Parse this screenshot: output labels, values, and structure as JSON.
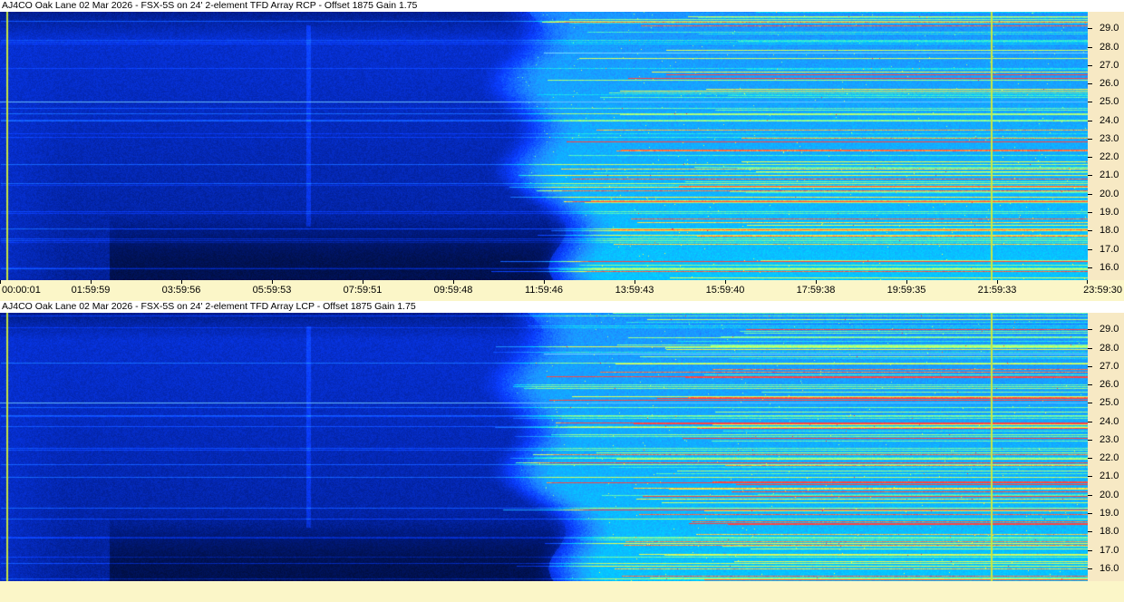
{
  "chart_data": [
    {
      "type": "heatmap",
      "title": "AJ4CO Oak Lane 02 Mar 2026 - FSX-5S on 24' 2-element TFD Array RCP  -  Offset 1875  Gain 1.75",
      "x_tick_labels": [
        "00:00:01",
        "01:59:59",
        "03:59:56",
        "05:59:53",
        "07:59:51",
        "09:59:48",
        "11:59:46",
        "13:59:43",
        "15:59:40",
        "17:59:38",
        "19:59:35",
        "21:59:33",
        "23:59:30"
      ],
      "y_tick_labels": [
        "29.0",
        "28.0",
        "27.0",
        "26.0",
        "25.0",
        "24.0",
        "23.0",
        "22.0",
        "21.0",
        "20.0",
        "19.0",
        "18.0",
        "17.0",
        "16.0"
      ],
      "y_values": [
        29.0,
        28.0,
        27.0,
        26.0,
        25.0,
        24.0,
        23.0,
        22.0,
        21.0,
        20.0,
        19.0,
        18.0,
        17.0,
        16.0
      ],
      "ylim": [
        15.3,
        29.9
      ],
      "xlim_hours": [
        0,
        24
      ],
      "colormap": [
        "#000820",
        "#001a80",
        "#0a3cff",
        "#1e90ff",
        "#00d4ff",
        "#7fffa0",
        "#ffff40",
        "#ff4040"
      ],
      "markers_hours": [
        0.15,
        21.86
      ],
      "marker_color": "#c8e640"
    },
    {
      "type": "heatmap",
      "title": "AJ4CO Oak Lane 02 Mar 2026 - FSX-5S on 24' 2-element TFD Array LCP  -  Offset 1875  Gain 1.75",
      "y_tick_labels": [
        "29.0",
        "28.0",
        "27.0",
        "26.0",
        "25.0",
        "24.0",
        "23.0",
        "22.0",
        "21.0",
        "20.0",
        "19.0",
        "18.0",
        "17.0",
        "16.0"
      ],
      "y_values": [
        29.0,
        28.0,
        27.0,
        26.0,
        25.0,
        24.0,
        23.0,
        22.0,
        21.0,
        20.0,
        19.0,
        18.0,
        17.0,
        16.0
      ],
      "ylim": [
        15.3,
        29.9
      ],
      "xlim_hours": [
        0,
        24
      ],
      "colormap": [
        "#000820",
        "#001a80",
        "#0a3cff",
        "#1e90ff",
        "#00d4ff",
        "#7fffa0",
        "#ffff40",
        "#ff4040"
      ],
      "markers_hours": [
        0.15,
        21.86
      ],
      "marker_color": "#c8e640"
    }
  ]
}
